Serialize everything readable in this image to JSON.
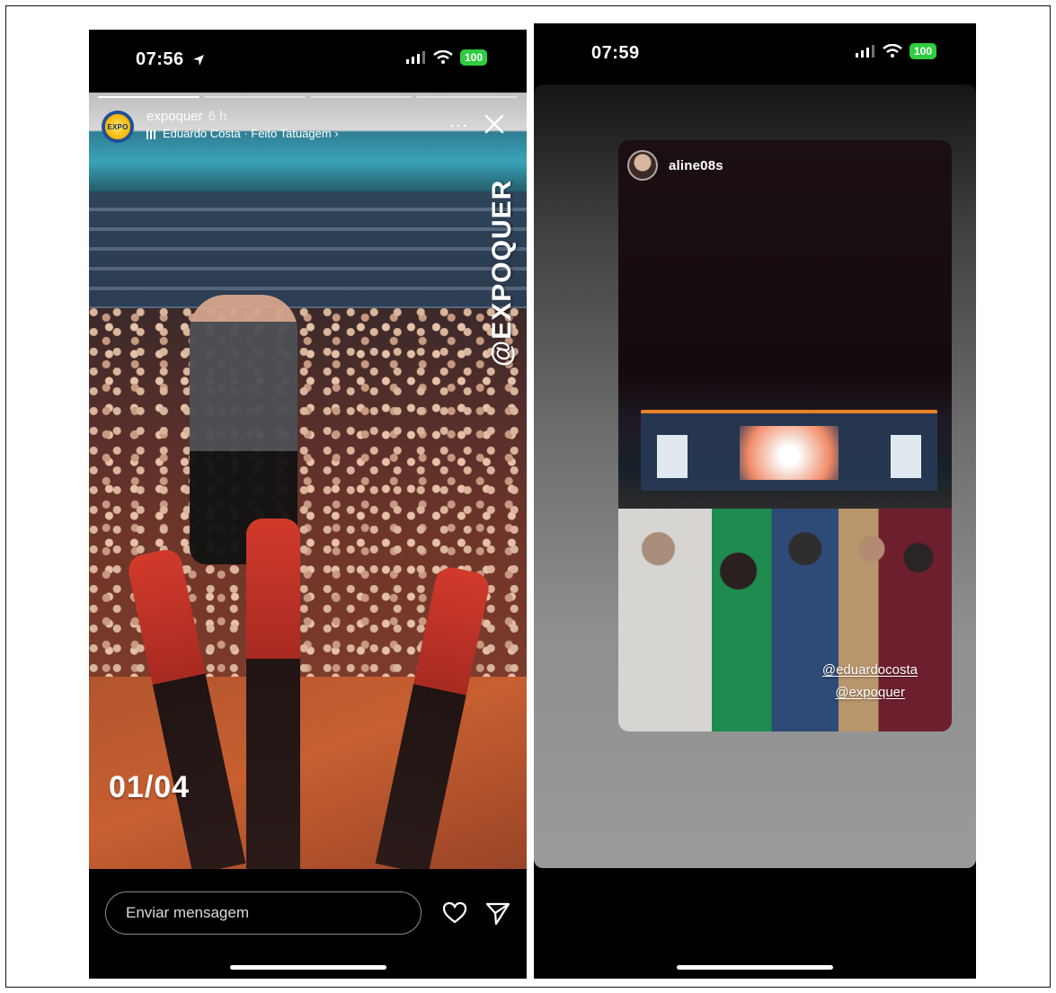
{
  "left_story": {
    "status_time": "07:56",
    "battery": "100",
    "account": "expoquer",
    "age": "6 h",
    "music": "Eduardo Costa · Feito Tatuagem",
    "music_arrow": "›",
    "menu": "···",
    "vertical_text": "@EXPOQUER",
    "counter": "01/04",
    "message_placeholder": "Enviar mensagem",
    "progress": {
      "segments": 4,
      "current": 1
    },
    "icons": [
      "location-arrow-icon",
      "signal-icon",
      "wifi-icon",
      "music-bars-icon",
      "more-icon",
      "close-icon",
      "heart-icon",
      "send-icon"
    ]
  },
  "right_story": {
    "status_time": "07:59",
    "battery": "100",
    "shared_user": "aline08s",
    "mentions": [
      "@eduardocosta",
      "@expoquer"
    ]
  },
  "colors": {
    "battery_green": "#2ecc40",
    "background": "#000000",
    "text": "#ffffff"
  }
}
